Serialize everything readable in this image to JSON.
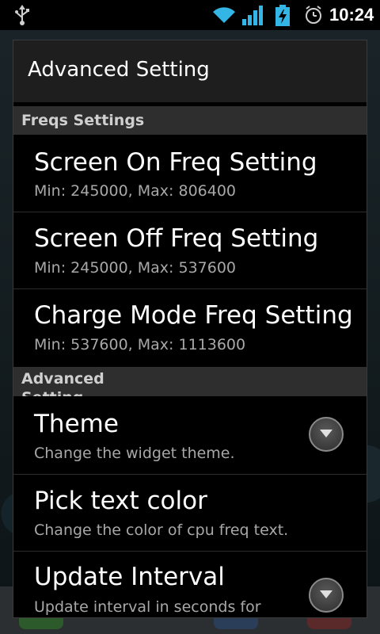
{
  "status_bar": {
    "time": "10:24",
    "icons": [
      "usb-icon",
      "wifi-icon",
      "signal-icon",
      "battery-charging-icon",
      "alarm-icon"
    ]
  },
  "dialog": {
    "title": "Advanced Setting",
    "sections": [
      {
        "header": "Freqs Settings",
        "items": [
          {
            "title": "Screen On Freq Setting",
            "summary": "Min: 245000, Max: 806400"
          },
          {
            "title": "Screen Off Freq Setting",
            "summary": "Min: 245000, Max: 537600"
          },
          {
            "title": "Charge Mode Freq Setting",
            "summary": "Min: 537600, Max: 1113600"
          }
        ]
      },
      {
        "header": "Advanced Setting",
        "items": [
          {
            "title": "Theme",
            "summary": "Change the widget theme.",
            "widget": "dropdown-icon"
          },
          {
            "title": "Pick text color",
            "summary": "Change the color of cpu freq text."
          },
          {
            "title": "Update Interval",
            "summary": "Update interval in seconds for",
            "widget": "dropdown-icon"
          }
        ]
      }
    ]
  },
  "colors": {
    "dialog_background": "#000000",
    "title_bar": "#1e1e1e",
    "section_header": "#2e2e2e",
    "primary_text": "#ffffff",
    "secondary_text": "#a8a8a8",
    "status_accent": "#33b5e5"
  }
}
